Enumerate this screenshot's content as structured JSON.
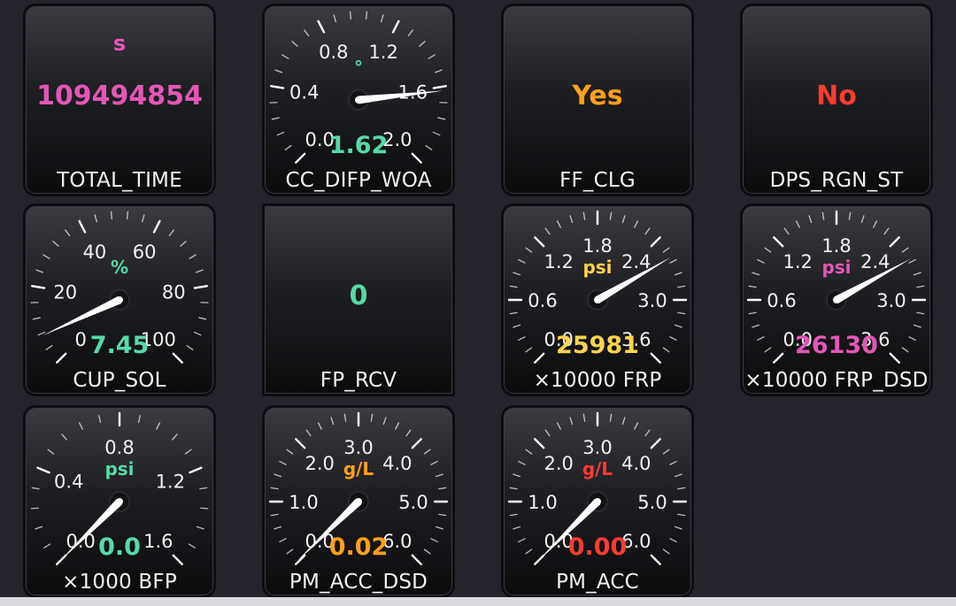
{
  "colors": {
    "magenta": "#e257b4",
    "green": "#57d9a6",
    "orange": "#ff9f1a",
    "red": "#ff3b30",
    "yellow": "#ffd34d",
    "tick": "#ffffff",
    "tick_label": "#f2f2f2"
  },
  "tiles": {
    "total_time": {
      "label": "TOTAL_TIME",
      "unit": "s",
      "value": "109494854"
    },
    "cc_difp_woa": {
      "label": "CC_DIFP_WOA",
      "unit": "°",
      "value": "1.62",
      "needle_value": 1.62,
      "min": 0.0,
      "max": 2.0,
      "ticks": [
        "0.0",
        "0.4",
        "0.8",
        "1.2",
        "1.6",
        "2.0"
      ]
    },
    "ff_clg": {
      "label": "FF_CLG",
      "value": "Yes"
    },
    "dps_rgn_st": {
      "label": "DPS_RGN_ST",
      "value": "No"
    },
    "cup_sol": {
      "label": "CUP_SOL",
      "unit": "%",
      "value": "7.45",
      "needle_value": 7.45,
      "min": 0,
      "max": 100,
      "ticks": [
        "0",
        "20",
        "40",
        "60",
        "80",
        "100"
      ]
    },
    "fp_rcv": {
      "label": "FP_RCV",
      "value": "0"
    },
    "frp": {
      "label": "×10000 FRP",
      "unit": "psi",
      "value": "25981",
      "needle_value": 2.5981,
      "min": 0.0,
      "max": 3.6,
      "ticks": [
        "0.0",
        "0.6",
        "1.2",
        "1.8",
        "2.4",
        "3.0",
        "3.6"
      ]
    },
    "frp_dsd": {
      "label": "×10000 FRP_DSD",
      "unit": "psi",
      "value": "26130",
      "needle_value": 2.613,
      "min": 0.0,
      "max": 3.6,
      "ticks": [
        "0.0",
        "0.6",
        "1.2",
        "1.8",
        "2.4",
        "3.0",
        "3.6"
      ]
    },
    "bfp": {
      "label": "×1000 BFP",
      "unit": "psi",
      "value": "0.0",
      "needle_value": 0.0,
      "min": 0.0,
      "max": 1.6,
      "ticks": [
        "0.0",
        "0.4",
        "0.8",
        "1.2",
        "1.6"
      ]
    },
    "pm_acc_dsd": {
      "label": "PM_ACC_DSD",
      "unit": "g/L",
      "value": "0.02",
      "needle_value": 0.02,
      "min": 0.0,
      "max": 6.0,
      "ticks": [
        "0.0",
        "1.0",
        "2.0",
        "3.0",
        "4.0",
        "5.0",
        "6.0"
      ]
    },
    "pm_acc": {
      "label": "PM_ACC",
      "unit": "g/L",
      "value": "0.00",
      "needle_value": 0.0,
      "min": 0.0,
      "max": 6.0,
      "ticks": [
        "0.0",
        "1.0",
        "2.0",
        "3.0",
        "4.0",
        "5.0",
        "6.0"
      ]
    }
  }
}
